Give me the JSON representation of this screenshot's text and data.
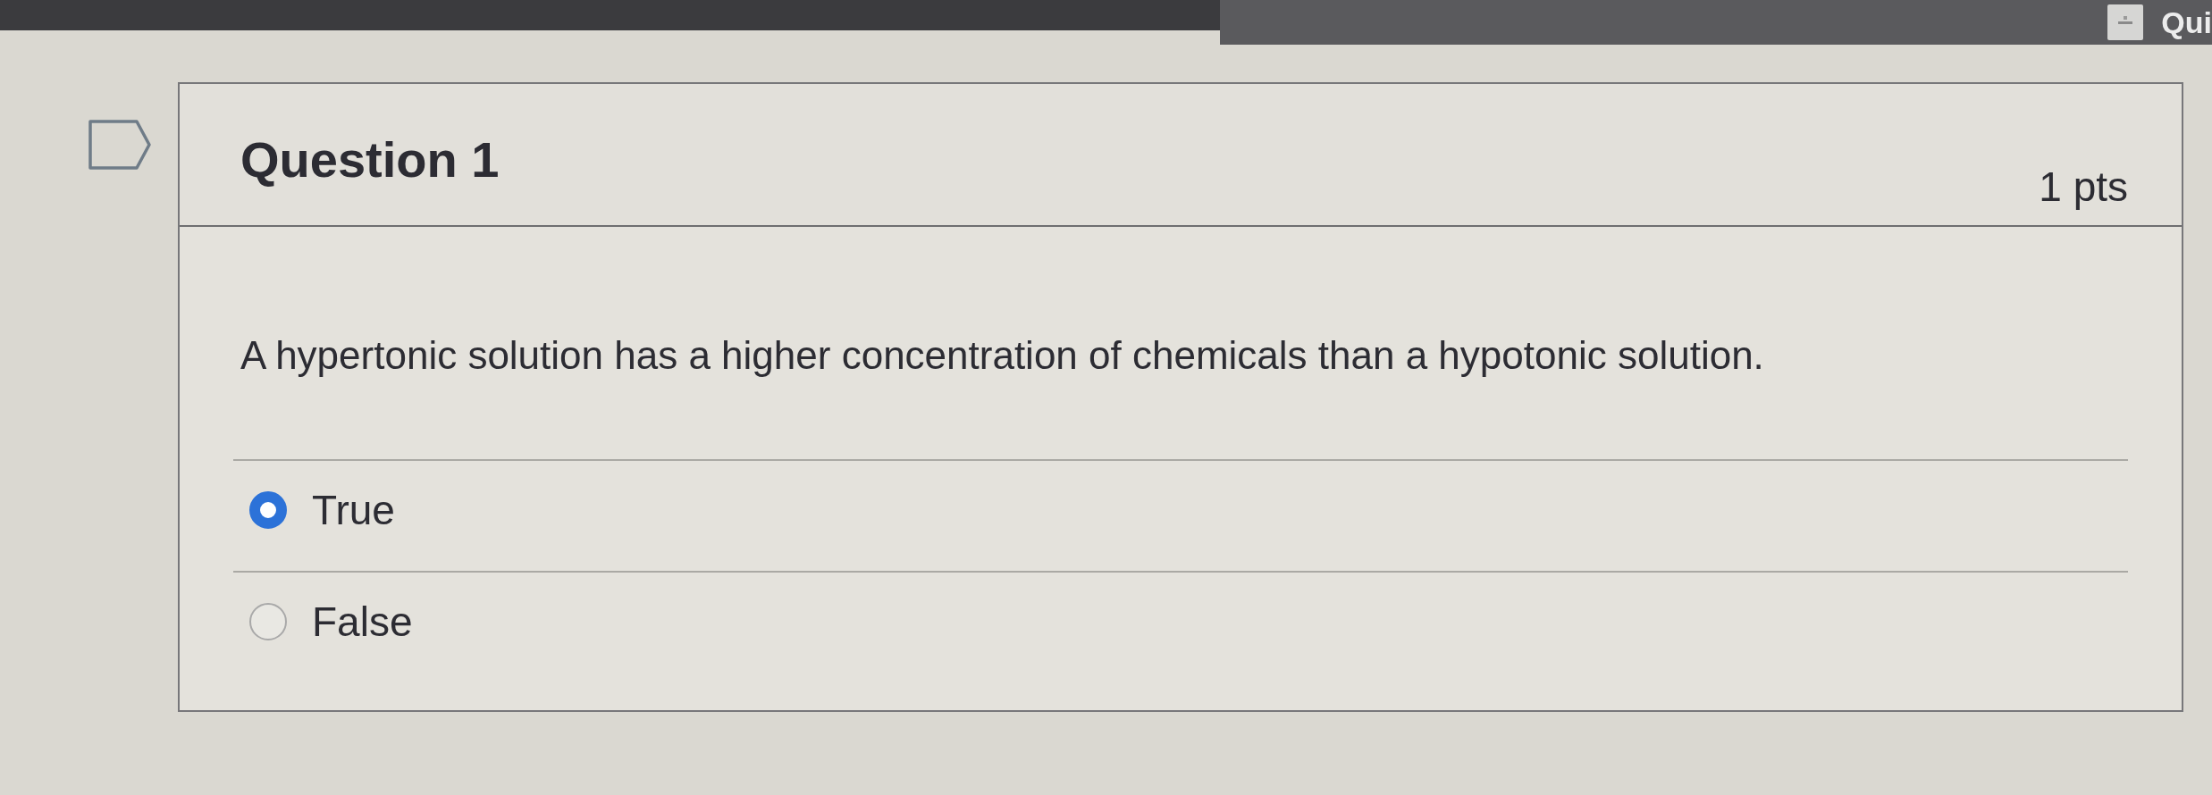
{
  "top_bar": {
    "label": "Qui"
  },
  "question": {
    "title": "Question 1",
    "points": "1 pts",
    "flagged": false,
    "text": "A hypertonic solution has a higher concentration of chemicals than a hypotonic solution.",
    "answers": [
      {
        "label": "True",
        "selected": true
      },
      {
        "label": "False",
        "selected": false
      }
    ]
  }
}
